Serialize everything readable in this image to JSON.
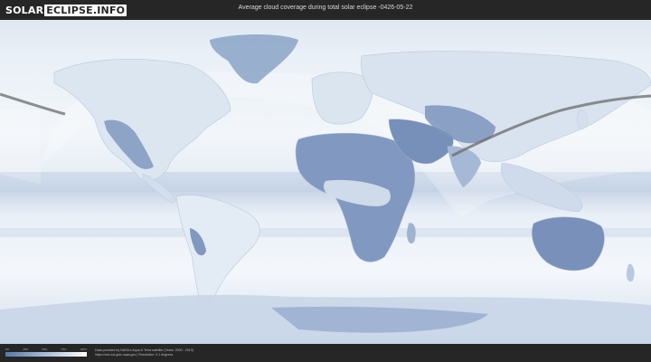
{
  "logo": {
    "solar": "SOLAR",
    "eclipse": "ECLIPSE.INFO"
  },
  "title": "Average cloud coverage during total solar eclipse -0426-05-22",
  "scale": {
    "ticks": [
      "0%",
      "25%",
      "50%",
      "75%",
      "100%"
    ]
  },
  "credits": {
    "line1": "Data provided by NASA's Aqua & Terra satellite (Years: 2000 - 2019)",
    "line2": "https://neo.sci.gsfc.nasa.gov | Resolution: 0.1 degrees"
  },
  "colors": {
    "cloudy": "#f4f7fb",
    "clear": "#7c95bd",
    "background": "#262626"
  }
}
